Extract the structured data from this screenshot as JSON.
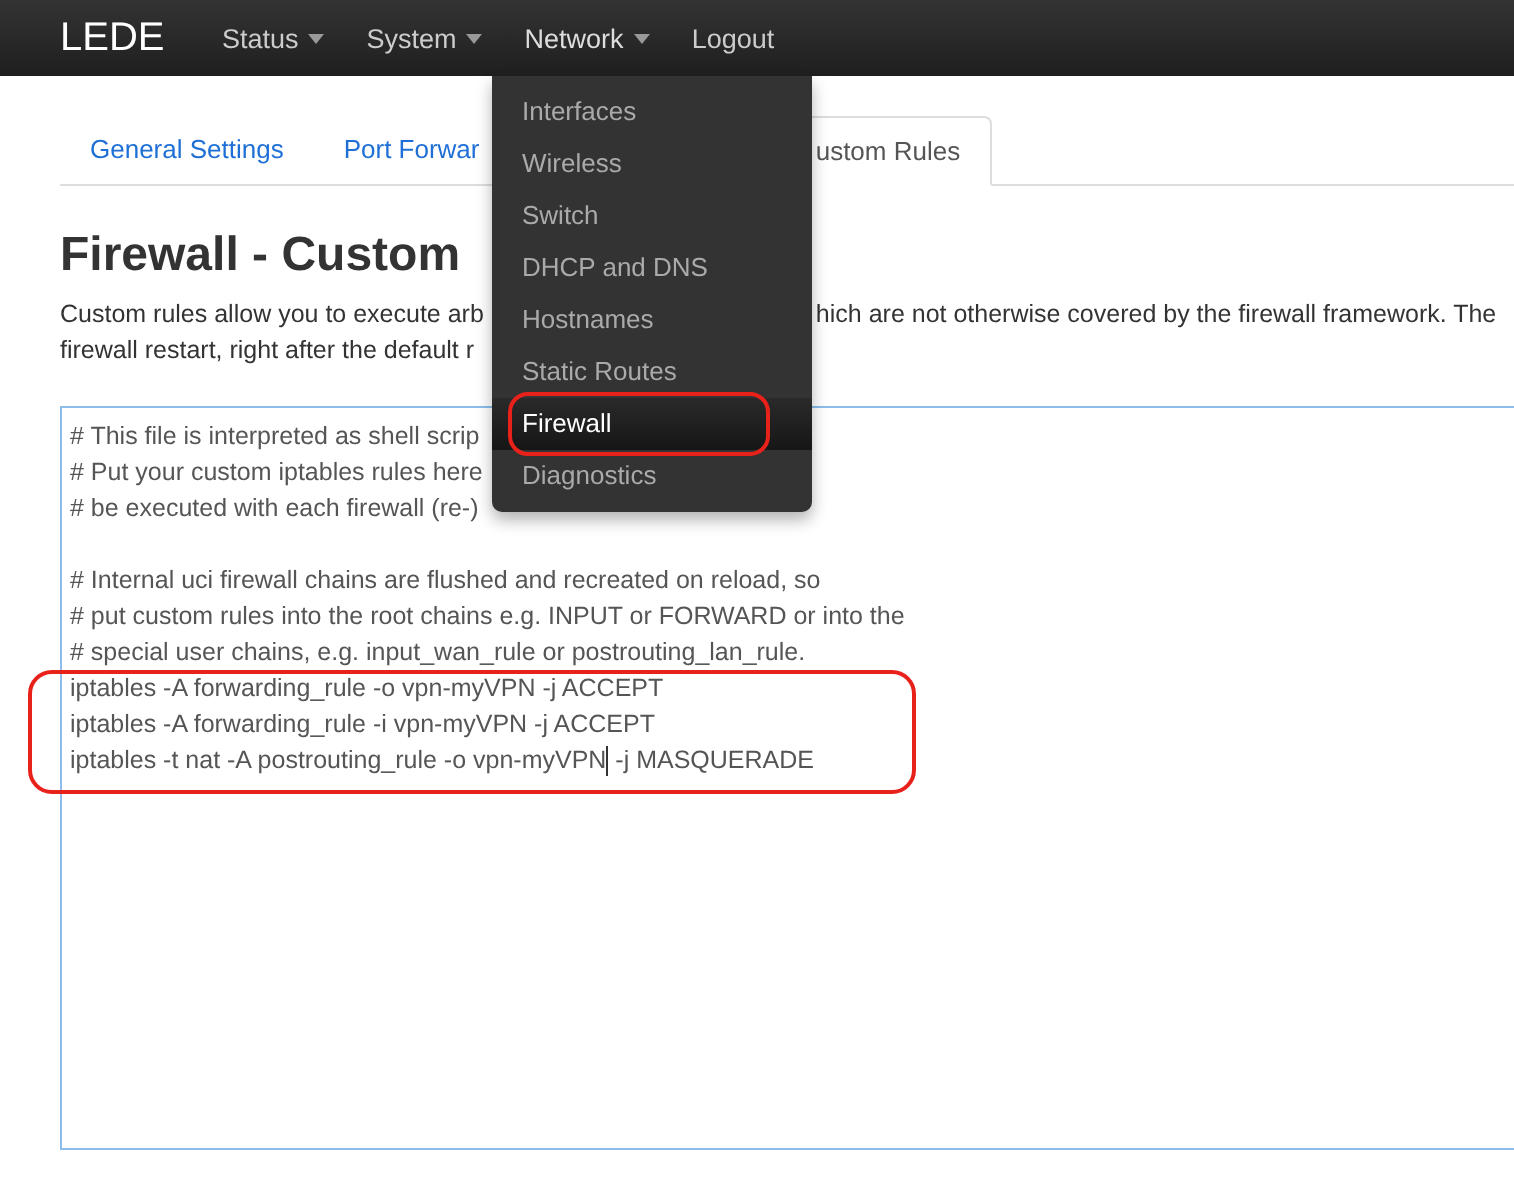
{
  "navbar": {
    "brand": "LEDE",
    "items": [
      {
        "label": "Status",
        "dropdown": true,
        "open": false
      },
      {
        "label": "System",
        "dropdown": true,
        "open": false
      },
      {
        "label": "Network",
        "dropdown": true,
        "open": true
      },
      {
        "label": "Logout",
        "dropdown": false,
        "open": false
      }
    ]
  },
  "menu": [
    {
      "label": "Interfaces",
      "selected": false,
      "highlighted": false
    },
    {
      "label": "Wireless",
      "selected": false,
      "highlighted": false
    },
    {
      "label": "Switch",
      "selected": false,
      "highlighted": false
    },
    {
      "label": "DHCP and DNS",
      "selected": false,
      "highlighted": false
    },
    {
      "label": "Hostnames",
      "selected": false,
      "highlighted": false
    },
    {
      "label": "Static Routes",
      "selected": false,
      "highlighted": false
    },
    {
      "label": "Firewall",
      "selected": true,
      "highlighted": true
    },
    {
      "label": "Diagnostics",
      "selected": false,
      "highlighted": false
    }
  ],
  "tabs": [
    {
      "label": "General Settings",
      "selected": false
    },
    {
      "label": "Port Forwar",
      "selected": false
    },
    {
      "label": "ustom Rules",
      "selected": true
    }
  ],
  "heading": "Firewall - Custom",
  "description": [
    {
      "left": "Custom rules allow you to execute arb",
      "right": "hich are not otherwise covered by the firewall framework. The"
    },
    {
      "left": "firewall restart, right after the default r"
    }
  ],
  "editor": {
    "focused": true,
    "lines": [
      {
        "parts": [
          "# This file is interpreted as shell scrip"
        ]
      },
      {
        "parts": [
          "# Put your custom iptables rules here"
        ]
      },
      {
        "parts": [
          "# be executed with each firewall (re-)"
        ]
      },
      {
        "parts": [
          "# Internal uci firewall chains are flushed and recreated on reload, so"
        ],
        "gap_before": true
      },
      {
        "parts": [
          "# put custom rules into the root chains e.g. INPUT or FORWARD or into the"
        ]
      },
      {
        "parts": [
          "# special user chains, e.g. input_wan_rule or postrouting_lan_rule."
        ]
      },
      {
        "parts": [
          "iptables -A forwarding_rule -o vpn-myVPN -j ACCEPT"
        ],
        "marked": true
      },
      {
        "parts": [
          "iptables -A forwarding_rule -i vpn-myVPN -j ACCEPT"
        ],
        "marked": true
      },
      {
        "parts": [
          "iptables -t nat -A postrouting_rule -o vpn-myVPN",
          " -j MASQUERADE"
        ],
        "marked": true,
        "cursor": true
      }
    ]
  }
}
